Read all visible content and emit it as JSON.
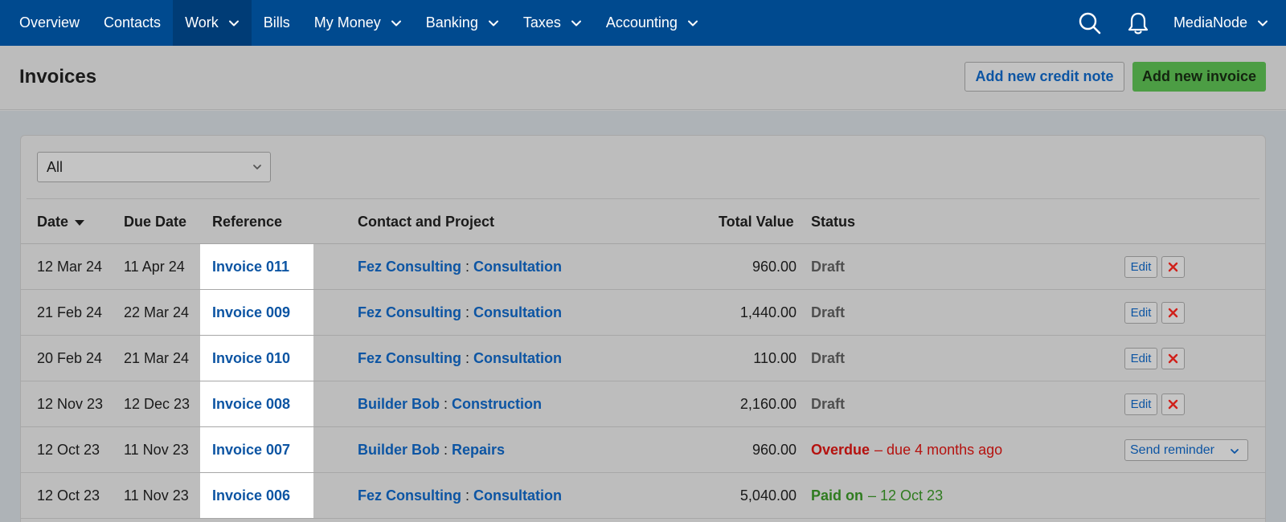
{
  "nav": {
    "items": [
      {
        "label": "Overview",
        "dropdown": false
      },
      {
        "label": "Contacts",
        "dropdown": false
      },
      {
        "label": "Work",
        "dropdown": true,
        "active": true
      },
      {
        "label": "Bills",
        "dropdown": false
      },
      {
        "label": "My Money",
        "dropdown": true
      },
      {
        "label": "Banking",
        "dropdown": true
      },
      {
        "label": "Taxes",
        "dropdown": true
      },
      {
        "label": "Accounting",
        "dropdown": true
      }
    ],
    "user_label": "MediaNode",
    "icons": [
      "search-icon",
      "bell-icon"
    ]
  },
  "header": {
    "title": "Invoices",
    "credit_note_button": "Add new credit note",
    "new_invoice_button": "Add new invoice"
  },
  "filter": {
    "selected": "All"
  },
  "table": {
    "columns": {
      "date": "Date",
      "due_date": "Due Date",
      "reference": "Reference",
      "contact_project": "Contact and Project",
      "total_value": "Total Value",
      "status": "Status"
    },
    "sort_indicator": "descending",
    "rows": [
      {
        "date": "12 Mar 24",
        "due": "11 Apr 24",
        "ref": "Invoice 011",
        "contact": "Fez Consulting",
        "project": "Consultation",
        "total": "960.00",
        "status_kind": "draft",
        "status": "Draft",
        "edit": "Edit"
      },
      {
        "date": "21 Feb 24",
        "due": "22 Mar 24",
        "ref": "Invoice 009",
        "contact": "Fez Consulting",
        "project": "Consultation",
        "total": "1,440.00",
        "status_kind": "draft",
        "status": "Draft",
        "edit": "Edit"
      },
      {
        "date": "20 Feb 24",
        "due": "21 Mar 24",
        "ref": "Invoice 010",
        "contact": "Fez Consulting",
        "project": "Consultation",
        "total": "110.00",
        "status_kind": "draft",
        "status": "Draft",
        "edit": "Edit"
      },
      {
        "date": "12 Nov 23",
        "due": "12 Dec 23",
        "ref": "Invoice 008",
        "contact": "Builder Bob",
        "project": "Construction",
        "total": "2,160.00",
        "status_kind": "draft",
        "status": "Draft",
        "edit": "Edit"
      },
      {
        "date": "12 Oct 23",
        "due": "11 Nov 23",
        "ref": "Invoice 007",
        "contact": "Builder Bob",
        "project": "Repairs",
        "total": "960.00",
        "status_kind": "overdue",
        "status": "Overdue",
        "status_detail": "– due 4 months ago",
        "reminder": "Send reminder"
      },
      {
        "date": "12 Oct 23",
        "due": "11 Nov 23",
        "ref": "Invoice 006",
        "contact": "Fez Consulting",
        "project": "Consultation",
        "total": "5,040.00",
        "status_kind": "paid",
        "status": "Paid on",
        "status_detail": "– 12 Oct 23"
      }
    ],
    "contact_separator": ":"
  },
  "colors": {
    "nav_bg": "#004a8f",
    "link_blue": "#0d55a3",
    "green_button": "#4c9d44",
    "overdue_red": "#b5120f",
    "paid_green": "#2f7b1f",
    "delete_red": "#d0201a"
  }
}
